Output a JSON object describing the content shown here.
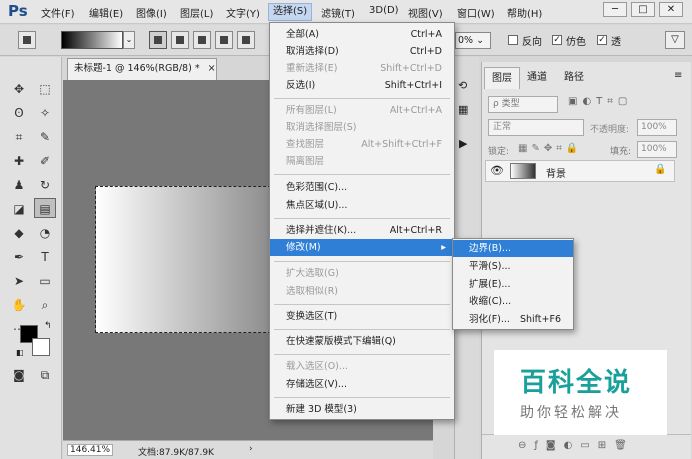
{
  "app": {
    "logo": "Ps"
  },
  "menubar": {
    "items": [
      "文件(F)",
      "编辑(E)",
      "图像(I)",
      "图层(L)",
      "文字(Y)",
      "选择(S)",
      "滤镜(T)",
      "3D(D)",
      "视图(V)",
      "窗口(W)",
      "帮助(H)"
    ],
    "window_buttons": [
      "─",
      "□",
      "✕"
    ]
  },
  "options": {
    "zoom_value": "0%",
    "checkboxes": [
      "反向",
      "仿色",
      "透"
    ],
    "mode_glyph": "▽"
  },
  "document": {
    "tab_title": "未标题-1 @ 146%(RGB/8) *",
    "tab_close": "×",
    "status_zoom": "146.41%",
    "status_doc": "文档:87.9K/87.9K"
  },
  "layers_panel": {
    "tabs": [
      "图层",
      "通道",
      "路径"
    ],
    "filter_label": "ρ 类型",
    "blend_mode": "正常",
    "opacity_label": "不透明度:",
    "opacity_value": "100%",
    "lock_label": "锁定:",
    "fill_label": "填充:",
    "fill_value": "100%",
    "layer_name": "背景"
  },
  "select_menu": {
    "items": [
      {
        "label": "全部(A)",
        "shortcut": "Ctrl+A",
        "disabled": false
      },
      {
        "label": "取消选择(D)",
        "shortcut": "Ctrl+D",
        "disabled": false
      },
      {
        "label": "重新选择(E)",
        "shortcut": "Shift+Ctrl+D",
        "disabled": true
      },
      {
        "label": "反选(I)",
        "shortcut": "Shift+Ctrl+I",
        "disabled": false
      },
      {
        "label": "所有图层(L)",
        "shortcut": "Alt+Ctrl+A",
        "disabled": true
      },
      {
        "label": "取消选择图层(S)",
        "shortcut": "",
        "disabled": true
      },
      {
        "label": "查找图层",
        "shortcut": "Alt+Shift+Ctrl+F",
        "disabled": true
      },
      {
        "label": "隔离图层",
        "shortcut": "",
        "disabled": true
      },
      {
        "label": "色彩范围(C)...",
        "shortcut": "",
        "disabled": false
      },
      {
        "label": "焦点区域(U)...",
        "shortcut": "",
        "disabled": false
      },
      {
        "label": "选择并遮住(K)...",
        "shortcut": "Alt+Ctrl+R",
        "disabled": false
      },
      {
        "label": "修改(M)",
        "shortcut": "",
        "disabled": false
      },
      {
        "label": "扩大选取(G)",
        "shortcut": "",
        "disabled": true
      },
      {
        "label": "选取相似(R)",
        "shortcut": "",
        "disabled": true
      },
      {
        "label": "变换选区(T)",
        "shortcut": "",
        "disabled": false
      },
      {
        "label": "在快速蒙版模式下编辑(Q)",
        "shortcut": "",
        "disabled": false
      },
      {
        "label": "载入选区(O)...",
        "shortcut": "",
        "disabled": true
      },
      {
        "label": "存储选区(V)...",
        "shortcut": "",
        "disabled": false
      },
      {
        "label": "新建 3D 模型(3)",
        "shortcut": "",
        "disabled": false
      }
    ],
    "submenu_arrow": "▸"
  },
  "modify_submenu": {
    "items": [
      {
        "label": "边界(B)...",
        "shortcut": ""
      },
      {
        "label": "平滑(S)...",
        "shortcut": ""
      },
      {
        "label": "扩展(E)...",
        "shortcut": ""
      },
      {
        "label": "收缩(C)...",
        "shortcut": ""
      },
      {
        "label": "羽化(F)...",
        "shortcut": "Shift+F6"
      }
    ]
  },
  "watermark": {
    "title": "百科全说",
    "subtitle": "助你轻松解决"
  },
  "colors": {
    "highlight": "#2f7fd6",
    "watermark": "#1aa09a"
  }
}
